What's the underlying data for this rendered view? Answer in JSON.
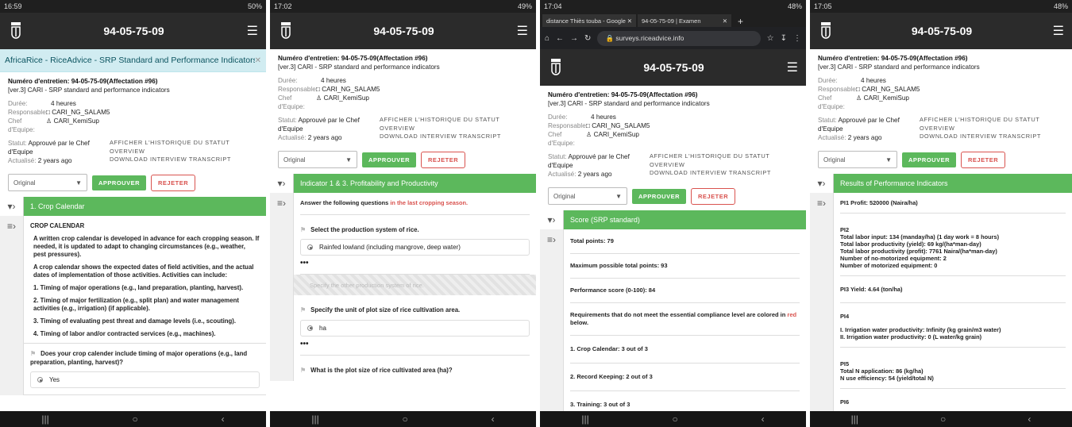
{
  "screens": [
    {
      "status_time": "16:59",
      "status_right": "50%",
      "title": "94-05-75-09",
      "banner": "AfricaRice - RiceAdvice - SRP Standard and Performance Indicators Surveys",
      "section": "1. Crop Calendar",
      "heading": "CROP CALENDAR",
      "paras": [
        "A written crop calendar is developed in advance for each cropping season. If needed, it is updated to adapt to changing circumstances (e.g., weather, pest pressures).",
        "A crop calendar shows the expected dates of field activities, and the actual dates of implementation of those activities. Activities can include:",
        "1. Timing of major operations (e.g., land preparation, planting, harvest).",
        "2. Timing of major fertilization (e.g., split plan) and water management activities (e.g., irrigation) (if applicable).",
        "3. Timing of evaluating pest threat and damage levels (i.e., scouting).",
        "4. Timing of labor and/or contracted services (e.g., machines)."
      ],
      "question": "Does your crop calender include timing of major operations (e.g., land preparation, planting, harvest)?",
      "answer": "Yes"
    },
    {
      "status_time": "17:02",
      "status_right": "49%",
      "title": "94-05-75-09",
      "section": "Indicator 1 & 3. Profitability and Productivity",
      "instr_a": "Answer the following questions ",
      "instr_b": "in the last cropping season.",
      "q1": "Select the production system of rice.",
      "a1": "Rainfed lowland (including mangrove, deep water)",
      "disabled": "Specify the other production system of rice.",
      "q2": "Specify the unit of plot size of rice cultivation area.",
      "a2": "ha",
      "q3": "What is the plot size of rice cultivated area (ha)?"
    },
    {
      "status_time": "17:04",
      "status_right": "48%",
      "title": "94-05-75-09",
      "tab1": "distance Thiès touba - Google",
      "tab2": "94-05-75-09 | Examen",
      "url": "surveys.riceadvice.info",
      "section": "Score (SRP standard)",
      "scores": [
        "Total points: 79",
        "Maximum possible total points: 93",
        "Performance score (0-100): 84"
      ],
      "req_a": "Requirements that do not meet the essential compliance level are colored in ",
      "req_b": "red",
      "req_c": " below.",
      "items": [
        "1. Crop Calendar: 3 out of 3",
        "2. Record Keeping: 2 out of 3",
        "3. Training: 3 out of 3"
      ]
    },
    {
      "status_time": "17:05",
      "status_right": "48%",
      "title": "94-05-75-09",
      "section": "Results of Performance Indicators",
      "pi1": "PI1 Profit: 520000 (Naira/ha)",
      "pi2": [
        "PI2",
        "Total labor input: 134 (manday/ha) (1 day work = 8 hours)",
        "Total labor productivity (yield): 69 kg/(ha*man-day)",
        "Total labor productivity (profit): 7761 Naira/(ha*man-day)",
        "Number of no-motorized equipment: 2",
        "Number of motorized equipment: 0"
      ],
      "pi3": "PI3 Yield: 4.64 (ton/ha)",
      "pi4": [
        "PI4",
        "I. Irrigation water productivity: Infinity (kg grain/m3 water)",
        "II. Irrigation water productivity: 0 (L water/kg grain)"
      ],
      "pi5": [
        "PI5",
        "Total N application: 86 (kg/ha)",
        "N use efficiency: 54 (yield/total N)"
      ],
      "pi6": "PI6"
    }
  ],
  "common": {
    "interview": "Numéro d'entretien: 94-05-75-09(Affectation #96)",
    "version": "[ver.3] CARI - SRP standard and performance indicators",
    "duree_l": "Durée:",
    "duree_v": "4 heures",
    "resp_l": "Responsable:",
    "resp_v": "CARI_NG_SALAM5",
    "chef_l": "Chef d'Equipe:",
    "chef_v": "CARI_KemiSup",
    "statut_l": "Statut:",
    "statut_v": "Approuvé par le Chef d'Equipe",
    "act_l": "Actualisé:",
    "act_v": "2 years ago",
    "link1": "AFFICHER L'HISTORIQUE DU STATUT",
    "link2": "OVERVIEW",
    "link3": "DOWNLOAD INTERVIEW TRANSCRIPT",
    "select": "Original",
    "approve": "APPROUVER",
    "reject": "REJETER"
  }
}
